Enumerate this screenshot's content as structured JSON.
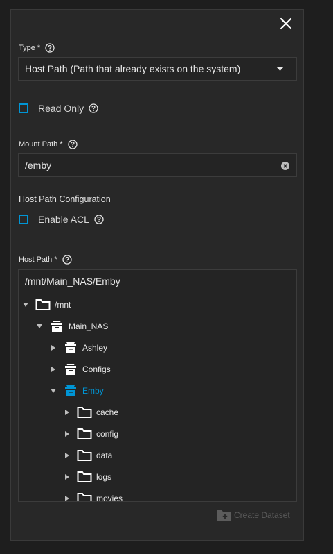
{
  "form": {
    "type_label": "Type *",
    "type_value": "Host Path (Path that already exists on the system)",
    "read_only_label": "Read Only",
    "mount_path_label": "Mount Path *",
    "mount_path_value": "/emby",
    "section_title": "Host Path Configuration",
    "enable_acl_label": "Enable ACL",
    "host_path_label": "Host Path *",
    "host_path_value": "/mnt/Main_NAS/Emby",
    "create_dataset_label": "Create Dataset"
  },
  "tree": [
    {
      "label": "/mnt",
      "icon": "folder-icon",
      "expanded": true,
      "level": 0
    },
    {
      "label": "Main_NAS",
      "icon": "dataset-icon",
      "expanded": true,
      "level": 1
    },
    {
      "label": "Ashley",
      "icon": "dataset-icon",
      "expanded": false,
      "level": 2
    },
    {
      "label": "Configs",
      "icon": "dataset-icon",
      "expanded": false,
      "level": 2
    },
    {
      "label": "Emby",
      "icon": "dataset-icon",
      "expanded": true,
      "level": 2,
      "selected": true
    },
    {
      "label": "cache",
      "icon": "folder-icon",
      "expanded": false,
      "level": 3
    },
    {
      "label": "config",
      "icon": "folder-icon",
      "expanded": false,
      "level": 3
    },
    {
      "label": "data",
      "icon": "folder-icon",
      "expanded": false,
      "level": 3
    },
    {
      "label": "logs",
      "icon": "folder-icon",
      "expanded": false,
      "level": 3
    },
    {
      "label": "movies",
      "icon": "folder-icon",
      "expanded": false,
      "level": 3
    }
  ],
  "colors": {
    "accent": "#0095d5",
    "background": "#282828",
    "disabled": "#5c5c5c"
  }
}
